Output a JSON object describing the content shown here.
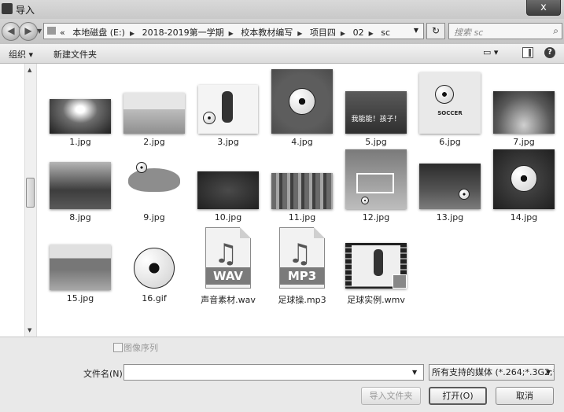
{
  "window": {
    "title": "导入",
    "close_glyph": "x"
  },
  "nav": {
    "back_glyph": "◀",
    "forward_glyph": "▶",
    "breadcrumbs": [
      "«",
      "本地磁盘 (E:)",
      "2018-2019第一学期",
      "校本教材编写",
      "项目四",
      "02",
      "sc"
    ],
    "refresh_glyph": "↻",
    "search_placeholder": "搜索 sc"
  },
  "toolbar": {
    "organize_label": "组织 ▾",
    "new_folder_label": "新建文件夹"
  },
  "files": [
    {
      "name": "1.jpg",
      "kind": "image"
    },
    {
      "name": "2.jpg",
      "kind": "image"
    },
    {
      "name": "3.jpg",
      "kind": "image"
    },
    {
      "name": "4.jpg",
      "kind": "image"
    },
    {
      "name": "5.jpg",
      "kind": "image",
      "caption": "我能能！孩子！"
    },
    {
      "name": "6.jpg",
      "kind": "image",
      "caption": "SOCCER"
    },
    {
      "name": "7.jpg",
      "kind": "image"
    },
    {
      "name": "8.jpg",
      "kind": "image"
    },
    {
      "name": "9.jpg",
      "kind": "image"
    },
    {
      "name": "10.jpg",
      "kind": "image"
    },
    {
      "name": "11.jpg",
      "kind": "image"
    },
    {
      "name": "12.jpg",
      "kind": "image"
    },
    {
      "name": "13.jpg",
      "kind": "image"
    },
    {
      "name": "14.jpg",
      "kind": "image"
    },
    {
      "name": "15.jpg",
      "kind": "image"
    },
    {
      "name": "16.gif",
      "kind": "image"
    },
    {
      "name": "声音素材.wav",
      "kind": "audio",
      "badge": "WAV"
    },
    {
      "name": "足球操.mp3",
      "kind": "audio",
      "badge": "MP3"
    },
    {
      "name": "足球实例.wmv",
      "kind": "video"
    }
  ],
  "bottom": {
    "image_sequence_label": "图像序列",
    "filename_label": "文件名(N):",
    "filename_value": "",
    "filter_value": "所有支持的媒体 (*.264;*.3G2;*",
    "import_folder_label": "导入文件夹",
    "open_label": "打开(O)",
    "cancel_label": "取消"
  }
}
